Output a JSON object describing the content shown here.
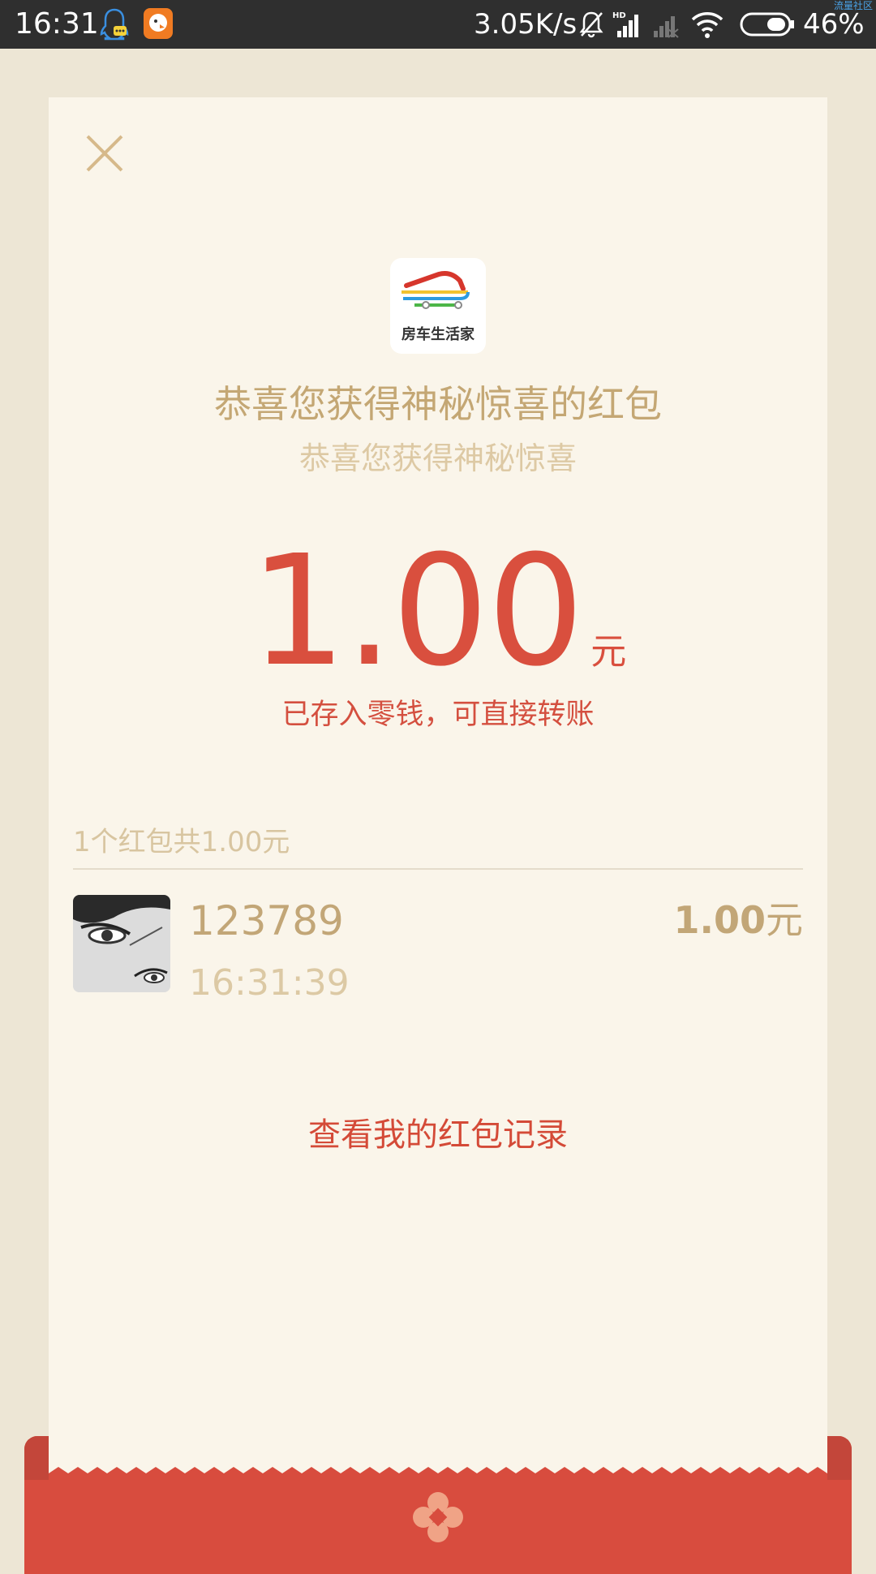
{
  "status_bar": {
    "time": "16:31",
    "network_speed": "3.05K/s",
    "battery": "46%",
    "corner_label": "流量社区",
    "icons": [
      "qq-icon",
      "app-icon",
      "bell-off-icon",
      "signal-hd-icon",
      "signal-off-icon",
      "wifi-icon",
      "battery-icon"
    ]
  },
  "red_packet": {
    "title": "恭喜您获得神秘惊喜的红包",
    "subtitle": "恭喜您获得神秘惊喜",
    "logo_text": "房车生活家",
    "amount": "1.00",
    "amount_unit": "元",
    "note": "已存入零钱，可直接转账",
    "summary": "1个红包共1.00元",
    "record": {
      "username": "123789",
      "time": "16:31:39",
      "amount": "1.00",
      "unit": "元"
    },
    "history_link": "查看我的红包记录"
  },
  "colors": {
    "accent_red": "#d94f3e",
    "gold": "#c4a774",
    "card_bg": "#faf5ea",
    "page_bg": "#ede6d5"
  }
}
